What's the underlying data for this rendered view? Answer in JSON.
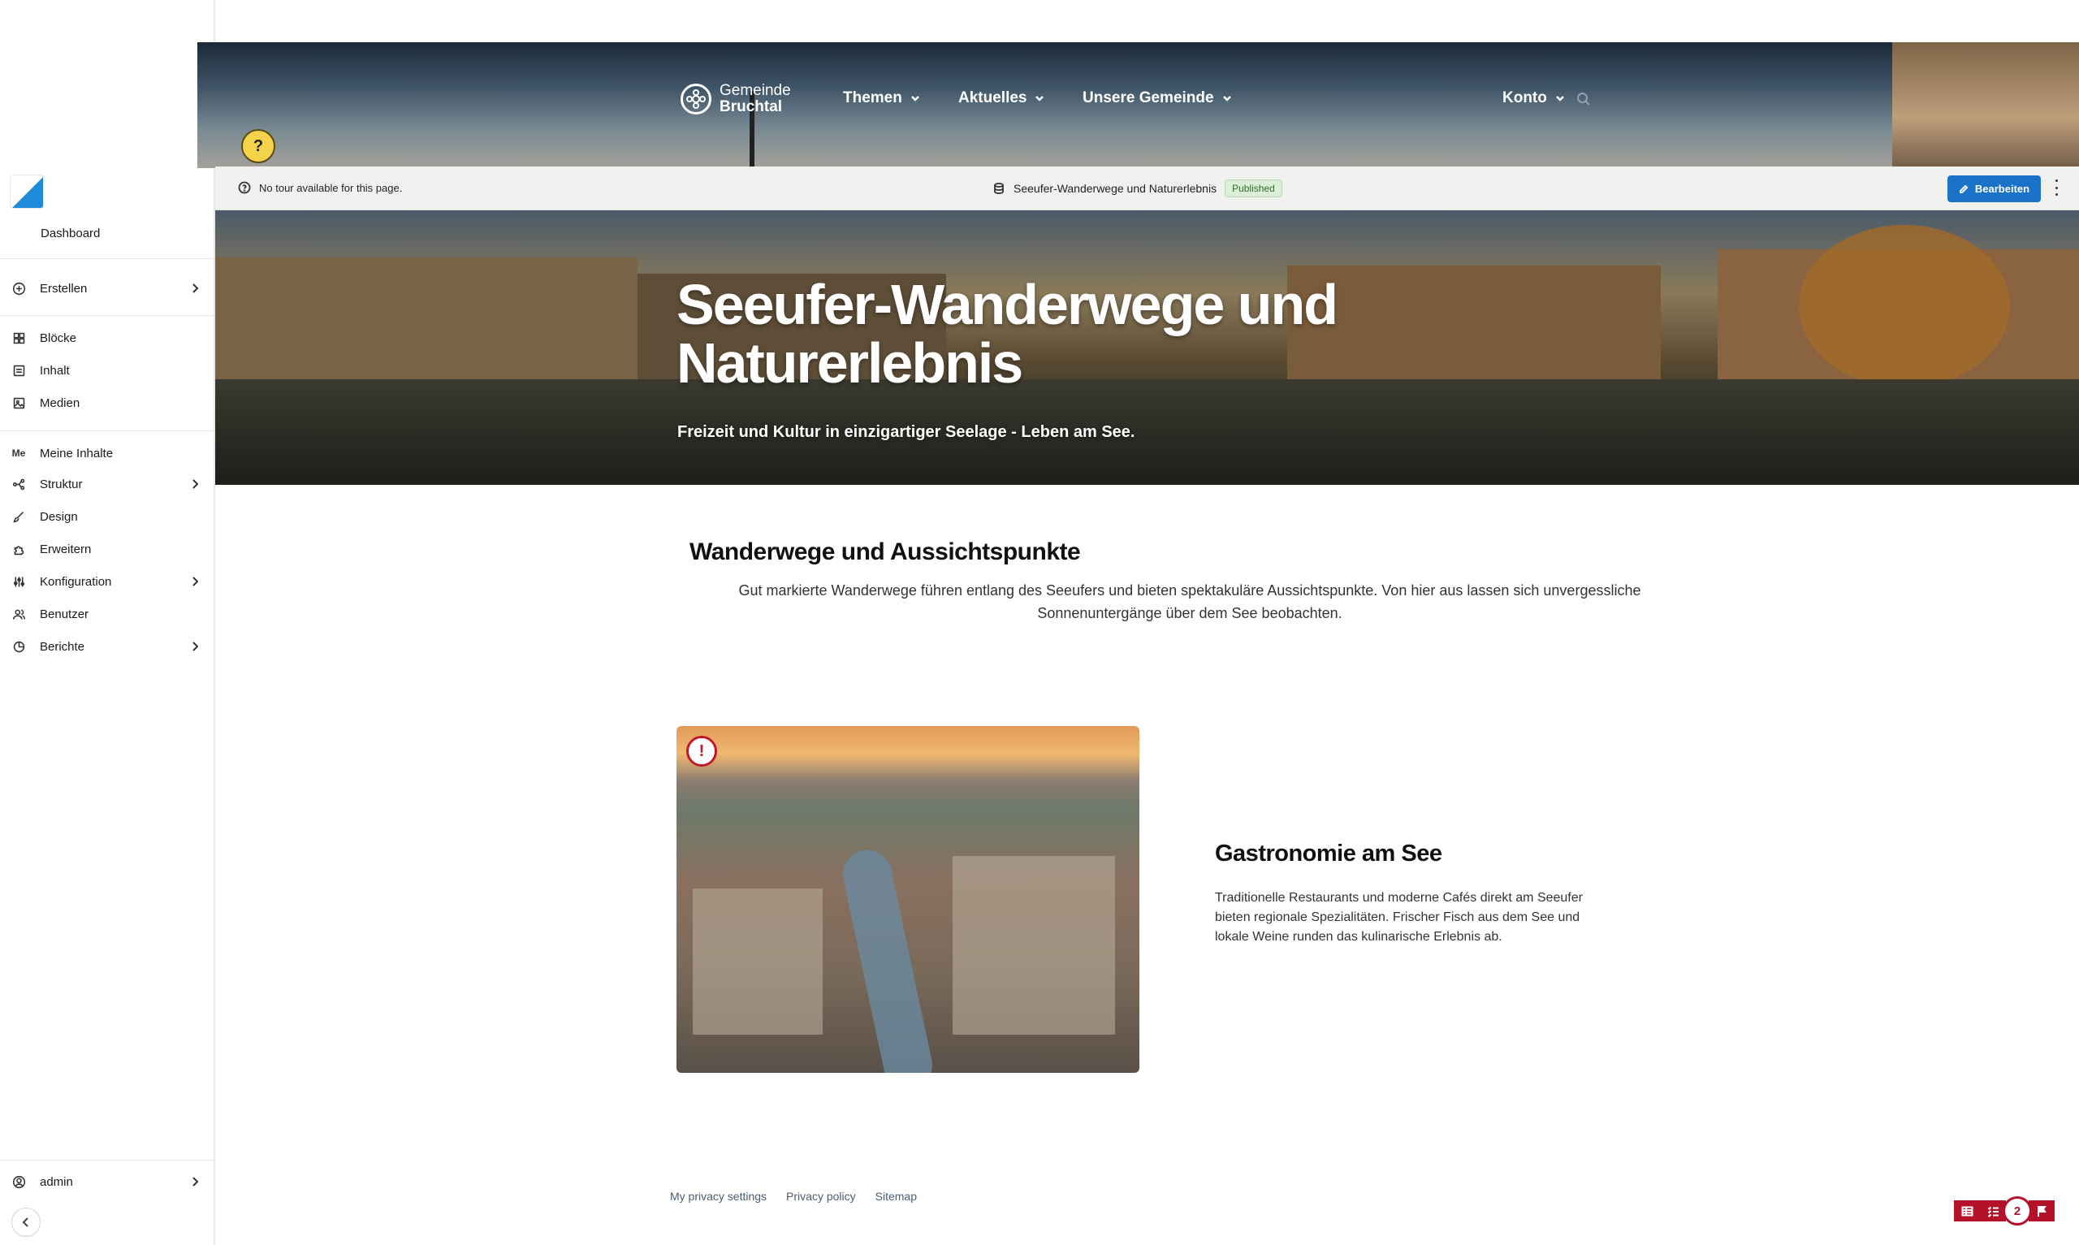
{
  "admin": {
    "dashboard_label": "Dashboard",
    "menu": [
      {
        "label": "Erstellen",
        "icon": "plus-circle-icon",
        "has_children": true
      },
      {
        "label": "Blöcke",
        "icon": "blocks-grid-icon",
        "has_children": false
      },
      {
        "label": "Inhalt",
        "icon": "content-list-icon",
        "has_children": false
      },
      {
        "label": "Medien",
        "icon": "media-image-icon",
        "has_children": false
      },
      {
        "label": "Meine Inhalte",
        "icon": "me-icon",
        "icon_text": "Me",
        "has_children": false
      },
      {
        "label": "Struktur",
        "icon": "structure-icon",
        "has_children": true
      },
      {
        "label": "Design",
        "icon": "paintbrush-icon",
        "has_children": false
      },
      {
        "label": "Erweitern",
        "icon": "puzzle-icon",
        "has_children": false
      },
      {
        "label": "Konfiguration",
        "icon": "sliders-icon",
        "has_children": true
      },
      {
        "label": "Benutzer",
        "icon": "users-icon",
        "has_children": false
      },
      {
        "label": "Berichte",
        "icon": "chart-pie-icon",
        "has_children": true
      }
    ],
    "user_label": "admin"
  },
  "site": {
    "brand_line1": "Gemeinde",
    "brand_line2": "Bruchtal",
    "nav": [
      "Themen",
      "Aktuelles",
      "Unsere Gemeinde"
    ],
    "account_label": "Konto",
    "help_symbol": "?"
  },
  "toolbar": {
    "tour_note": "No tour available for this page.",
    "page_title": "Seeufer-Wanderwege und Naturerlebnis",
    "status": "Published",
    "edit_label": "Bearbeiten"
  },
  "hero": {
    "title": "Seeufer-Wanderwege und Naturerlebnis",
    "subtitle": "Freizeit und Kultur in einzigartiger Seelage - Leben am See."
  },
  "section1": {
    "title": "Wanderwege und Aussichtspunkte",
    "text": "Gut markierte Wanderwege führen entlang des Seeufers und bieten spektakuläre Aussichtspunkte. Von hier aus lassen sich unvergessliche Sonnenuntergänge über dem See beobachten."
  },
  "section2": {
    "alert_symbol": "!",
    "title": "Gastronomie am See",
    "text": "Traditionelle Restaurants und moderne Cafés direkt am Seeufer bieten regionale Spezialitäten. Frischer Fisch aus dem See und lokale Weine runden das kulinarische Erlebnis ab."
  },
  "footer": {
    "links": [
      "My privacy settings",
      "Privacy policy",
      "Sitemap"
    ]
  },
  "devtools": {
    "count": "2"
  },
  "colors": {
    "accent_blue": "#1a73c8",
    "alert_red": "#b4122a",
    "published_green": "#2f6b2f"
  }
}
